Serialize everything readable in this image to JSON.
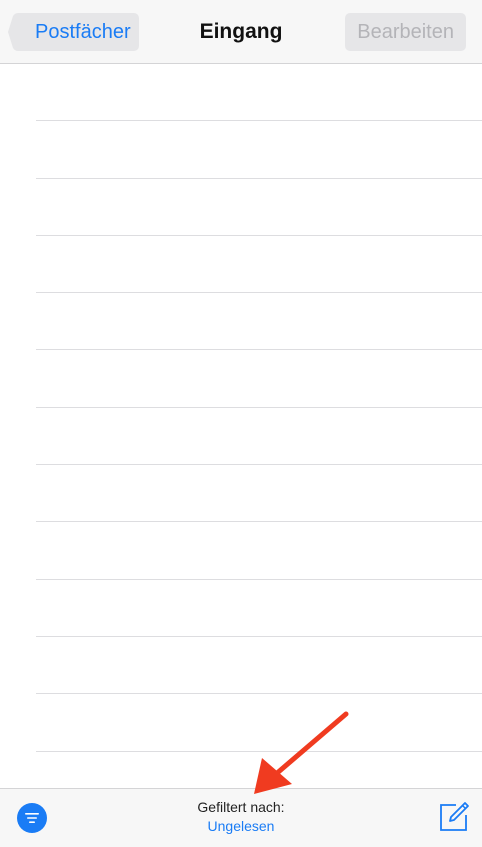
{
  "navbar": {
    "back_label": "Postfächer",
    "title": "Eingang",
    "edit_label": "Bearbeiten"
  },
  "list": {
    "empty_rows": 12
  },
  "toolbar": {
    "filter_icon": "filter-lines-icon",
    "filter_label": "Gefiltert nach:",
    "filter_value": "Ungelesen",
    "compose_icon": "compose-icon"
  },
  "colors": {
    "accent": "#1a7cf5",
    "disabled": "#b4b4b8",
    "bar_background": "#f7f7f7",
    "button_background": "#e6e6e8",
    "annotation": "#f03b20"
  }
}
